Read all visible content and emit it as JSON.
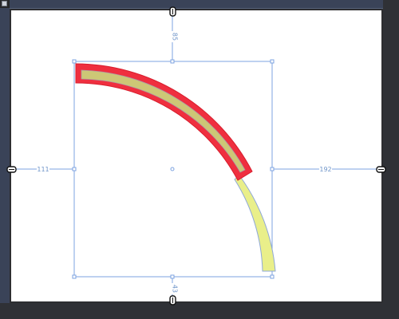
{
  "window": {
    "corner_icon": "app-menu-icon"
  },
  "margins": {
    "top": "85",
    "left": "111",
    "right": "192",
    "bottom": "43"
  },
  "handles": {
    "icon": "anchor-link-icon"
  },
  "colors": {
    "selection_outline": "#7da3e0",
    "arc_highlight_outer": "#ef2f3f",
    "arc_highlight_fill": "#cdc776",
    "arc_tail_fill": "#e9ef8a",
    "arc_tail_stroke": "#8fa8d8",
    "canvas_bg": "#ffffff",
    "frame_bg": "#3a4358"
  }
}
